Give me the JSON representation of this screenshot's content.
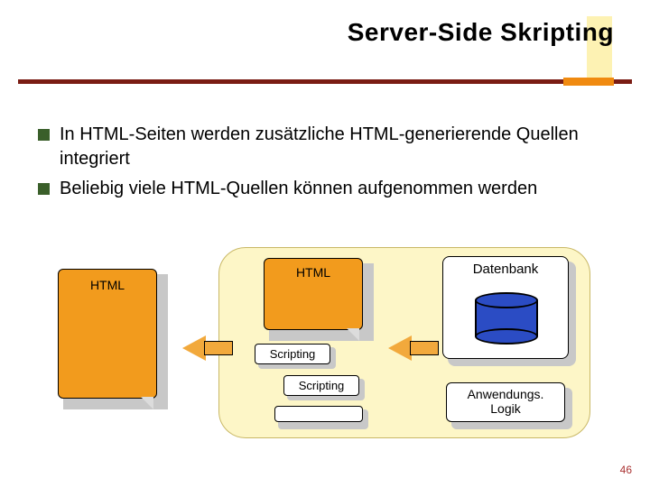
{
  "slide": {
    "title": "Server-Side Skripting",
    "page_number": "46"
  },
  "bullets": [
    "In HTML-Seiten werden zusätzliche HTML-generierende Quellen integriert",
    "Beliebig viele HTML-Quellen können aufgenommen werden"
  ],
  "diagram": {
    "left_page_label": "HTML",
    "right_page_label": "HTML",
    "script_box_1": "Scripting",
    "script_box_2": "Scripting",
    "database_label": "Datenbank",
    "app_logic_line1": "Anwendungs.",
    "app_logic_line2": "Logik"
  }
}
